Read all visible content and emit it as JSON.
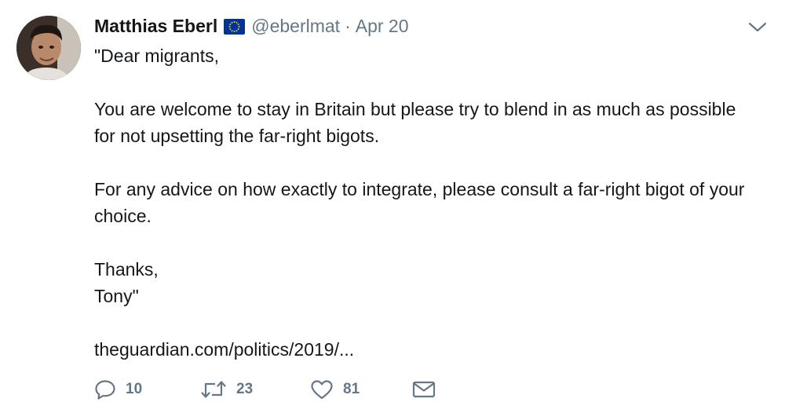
{
  "tweet": {
    "author": {
      "name": "Matthias Eberl",
      "badge_icon": "eu-flag-icon",
      "handle": "@eberlmat"
    },
    "separator": "·",
    "date": "Apr 20",
    "menu_icon": "chevron-down-icon",
    "text": {
      "line1": "\"Dear migrants,",
      "paragraph2": "You are welcome to stay in Britain but please try to blend in as much as possible for not upsetting the far-right bigots.",
      "paragraph3": "For any advice on how exactly to integrate, please consult a far-right bigot of your choice.",
      "closing1": "Thanks,",
      "closing2": "Tony\"",
      "link": "theguardian.com/politics/2019/..."
    },
    "actions": {
      "reply": {
        "icon": "reply-icon",
        "count": "10"
      },
      "retweet": {
        "icon": "retweet-icon",
        "count": "23"
      },
      "like": {
        "icon": "heart-icon",
        "count": "81"
      },
      "message": {
        "icon": "envelope-icon"
      }
    }
  },
  "colors": {
    "text": "#14171a",
    "secondary": "#657786",
    "eu_blue": "#003399",
    "eu_gold": "#ffcc00"
  }
}
